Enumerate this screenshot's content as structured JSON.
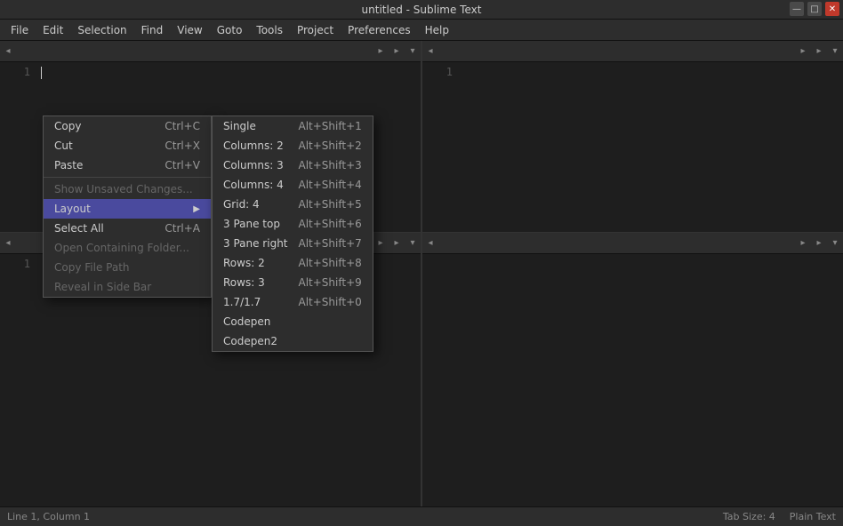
{
  "title_bar": {
    "title": "untitled - Sublime Text",
    "minimize_label": "—",
    "maximize_label": "□",
    "close_label": "✕"
  },
  "menu_bar": {
    "items": [
      "File",
      "Edit",
      "Selection",
      "Find",
      "View",
      "Goto",
      "Tools",
      "Project",
      "Preferences",
      "Help"
    ]
  },
  "context_menu": {
    "items": [
      {
        "label": "Copy",
        "shortcut": "Ctrl+C",
        "disabled": false,
        "submenu": false
      },
      {
        "label": "Cut",
        "shortcut": "Ctrl+X",
        "disabled": false,
        "submenu": false
      },
      {
        "label": "Paste",
        "shortcut": "Ctrl+V",
        "disabled": false,
        "submenu": false
      },
      {
        "label": "Show Unsaved Changes...",
        "shortcut": "",
        "disabled": true,
        "submenu": false
      },
      {
        "label": "Layout",
        "shortcut": "",
        "disabled": false,
        "submenu": true,
        "active": true
      },
      {
        "label": "Select All",
        "shortcut": "Ctrl+A",
        "disabled": false,
        "submenu": false
      },
      {
        "label": "Open Containing Folder...",
        "shortcut": "",
        "disabled": true,
        "submenu": false
      },
      {
        "label": "Copy File Path",
        "shortcut": "",
        "disabled": true,
        "submenu": false
      },
      {
        "label": "Reveal in Side Bar",
        "shortcut": "",
        "disabled": true,
        "submenu": false
      }
    ]
  },
  "submenu": {
    "items": [
      {
        "label": "Single",
        "shortcut": "Alt+Shift+1"
      },
      {
        "label": "Columns: 2",
        "shortcut": "Alt+Shift+2"
      },
      {
        "label": "Columns: 3",
        "shortcut": "Alt+Shift+3"
      },
      {
        "label": "Columns: 4",
        "shortcut": "Alt+Shift+4"
      },
      {
        "label": "Grid: 4",
        "shortcut": "Alt+Shift+5"
      },
      {
        "label": "3 Pane top",
        "shortcut": "Alt+Shift+6"
      },
      {
        "label": "3 Pane right",
        "shortcut": "Alt+Shift+7"
      },
      {
        "label": "Rows: 2",
        "shortcut": "Alt+Shift+8"
      },
      {
        "label": "Rows: 3",
        "shortcut": "Alt+Shift+9"
      },
      {
        "label": "1.7/1.7",
        "shortcut": "Alt+Shift+0"
      },
      {
        "label": "Codepen",
        "shortcut": ""
      },
      {
        "label": "Codepen2",
        "shortcut": ""
      }
    ]
  },
  "status_bar": {
    "left": "Line 1, Column 1",
    "right_tab": "Tab Size: 4",
    "right_syntax": "Plain Text"
  },
  "panes": [
    {
      "line_numbers": [
        "1"
      ],
      "tab_label": ""
    },
    {
      "line_numbers": [
        "1"
      ],
      "tab_label": ""
    }
  ],
  "bottom_panes": [
    {
      "line_numbers": [
        "1"
      ],
      "tab_label": ""
    }
  ]
}
